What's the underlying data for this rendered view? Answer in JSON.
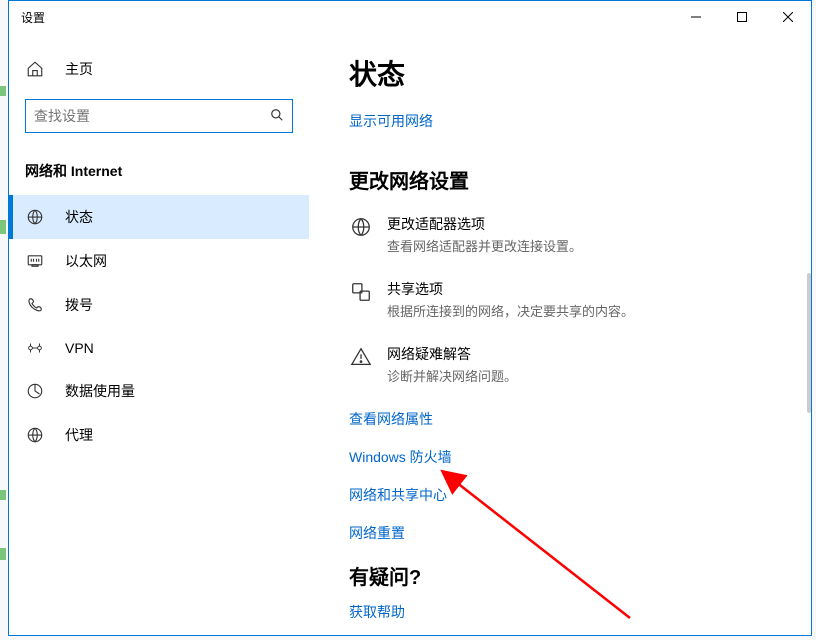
{
  "window": {
    "title": "设置"
  },
  "sidebar": {
    "home": "主页",
    "search_placeholder": "查找设置",
    "section": "网络和 Internet",
    "items": [
      {
        "label": "状态",
        "active": true
      },
      {
        "label": "以太网",
        "active": false
      },
      {
        "label": "拨号",
        "active": false
      },
      {
        "label": "VPN",
        "active": false
      },
      {
        "label": "数据使用量",
        "active": false
      },
      {
        "label": "代理",
        "active": false
      }
    ]
  },
  "main": {
    "heading": "状态",
    "show_networks": "显示可用网络",
    "change_settings": "更改网络设置",
    "options": [
      {
        "title": "更改适配器选项",
        "desc": "查看网络适配器并更改连接设置。"
      },
      {
        "title": "共享选项",
        "desc": "根据所连接到的网络，决定要共享的内容。"
      },
      {
        "title": "网络疑难解答",
        "desc": "诊断并解决网络问题。"
      }
    ],
    "links": [
      "查看网络属性",
      "Windows 防火墙",
      "网络和共享中心",
      "网络重置"
    ],
    "question": "有疑问?",
    "help": "获取帮助"
  }
}
